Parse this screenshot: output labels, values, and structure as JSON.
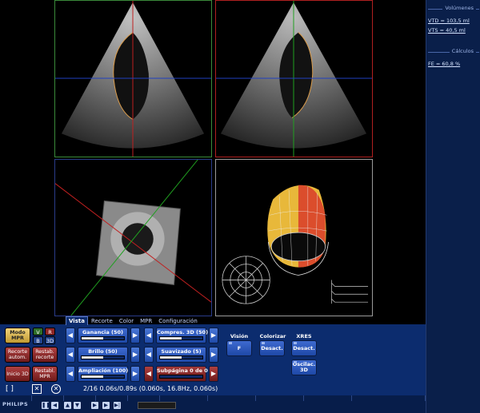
{
  "side_panel": {
    "volumes_header": "Volúmenes",
    "vtd": "VTD = 103,5 ml",
    "vts": "VTS = 40,5 ml",
    "calc_header": "Cálculos",
    "fe": "FE = 60,8 %"
  },
  "tabs": [
    "Vista",
    "Recorte",
    "Color",
    "MPR",
    "Configuración"
  ],
  "active_tab": "Vista",
  "mode_buttons": {
    "modo_mpr": "Modo MPR",
    "recorte_autom": "Recorte autom.",
    "restab_recorte": "Restab. recorte",
    "inicio_3d": "Inicio 3D",
    "restabl_mpr": "Restabl. MPR",
    "v": "V",
    "r": "R",
    "b": "B",
    "three_d": "3D"
  },
  "sliders": {
    "ganancia": {
      "label": "Ganancia (50)",
      "level": 0.5
    },
    "compres_3d": {
      "label": "Compres. 3D (50)",
      "level": 0.5
    },
    "brillo": {
      "label": "Brillo (50)",
      "level": 0.5
    },
    "suavizado": {
      "label": "Suavizado (5)",
      "level": 0.5
    },
    "ampliacion": {
      "label": "Ampliación (100)",
      "level": 0.5
    },
    "subpagina": {
      "label": "Subpágina 0 de 0",
      "level": 0.0
    }
  },
  "options": {
    "vision_label": "Visión",
    "vision_value": "F",
    "colorizar_label": "Colorizar",
    "colorizar_value": "Desact.",
    "xres_label": "XRES",
    "xres_value": "Desact.",
    "oscilac": "Oscilac. 3D"
  },
  "status": {
    "frame_info": "2/16  0.06s/0.89s  (0.060s, 16.8Hz, 0.060s)"
  },
  "brand": "PHILIPS",
  "icons": {
    "frame": "frame-icon",
    "close": "close-box-icon",
    "cancel": "cancel-circle-icon"
  },
  "colors": {
    "panel_bg": "#0c2c6e",
    "side_bg": "#0a1f4a",
    "button_red": "#8e2626",
    "button_gold": "#e0be5a",
    "button_blue": "#2a5bc4"
  }
}
